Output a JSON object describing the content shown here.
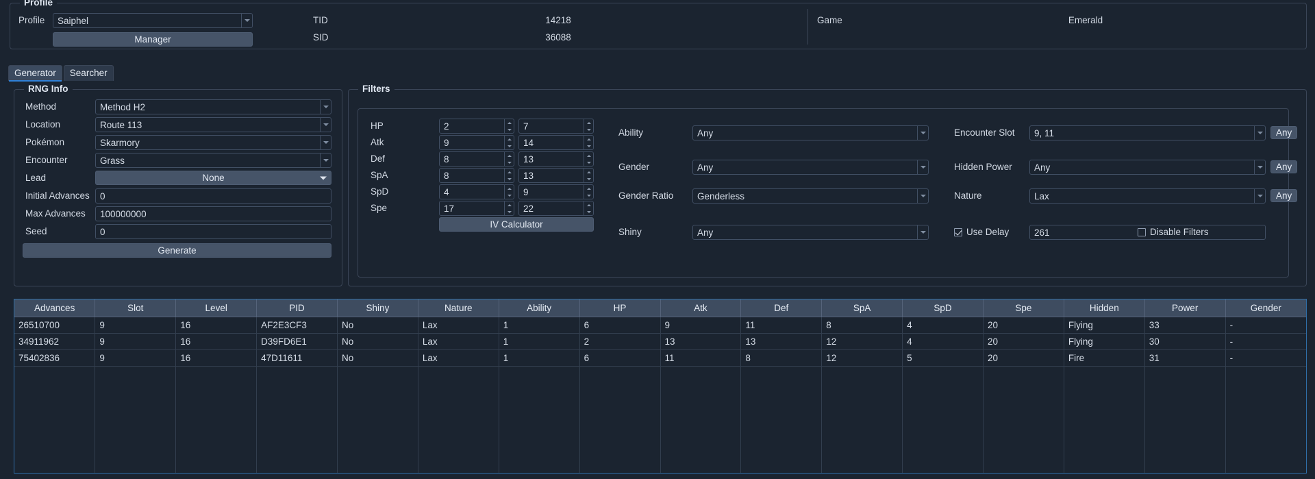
{
  "profile": {
    "group_title": "Profile",
    "profile_label": "Profile",
    "profile_value": "Saiphel",
    "manager_label": "Manager",
    "tid_label": "TID",
    "tid_value": "14218",
    "sid_label": "SID",
    "sid_value": "36088",
    "game_label": "Game",
    "game_value": "Emerald"
  },
  "tabs": [
    {
      "label": "Generator",
      "active": true
    },
    {
      "label": "Searcher",
      "active": false
    }
  ],
  "rng_info": {
    "group_title": "RNG Info",
    "rows": [
      {
        "label": "Method",
        "value": "Method H2",
        "type": "combo"
      },
      {
        "label": "Location",
        "value": "Route 113",
        "type": "combo"
      },
      {
        "label": "Pokémon",
        "value": "Skarmory",
        "type": "combo"
      },
      {
        "label": "Encounter",
        "value": "Grass",
        "type": "combo"
      },
      {
        "label": "Lead",
        "value": "None",
        "type": "button-combo"
      },
      {
        "label": "Initial Advances",
        "value": "0",
        "type": "text"
      },
      {
        "label": "Max Advances",
        "value": "100000000",
        "type": "text"
      },
      {
        "label": "Seed",
        "value": "0",
        "type": "text"
      }
    ],
    "generate_label": "Generate"
  },
  "filters": {
    "group_title": "Filters",
    "iv_rows": [
      {
        "label": "HP",
        "min": "2",
        "max": "7"
      },
      {
        "label": "Atk",
        "min": "9",
        "max": "14"
      },
      {
        "label": "Def",
        "min": "8",
        "max": "13"
      },
      {
        "label": "SpA",
        "min": "8",
        "max": "13"
      },
      {
        "label": "SpD",
        "min": "4",
        "max": "9"
      },
      {
        "label": "Spe",
        "min": "17",
        "max": "22"
      }
    ],
    "iv_calculator_label": "IV Calculator",
    "mid_rows": [
      {
        "label": "Ability",
        "value": "Any"
      },
      {
        "label": "Gender",
        "value": "Any"
      },
      {
        "label": "Gender Ratio",
        "value": "Genderless"
      },
      {
        "label": "Shiny",
        "value": "Any"
      }
    ],
    "right_rows": [
      {
        "label": "Encounter Slot",
        "value": "9, 11",
        "any_label": "Any"
      },
      {
        "label": "Hidden Power",
        "value": "Any",
        "any_label": "Any"
      },
      {
        "label": "Nature",
        "value": "Lax",
        "any_label": "Any"
      }
    ],
    "use_delay_label": "Use Delay",
    "use_delay_checked": true,
    "delay_value": "261",
    "disable_filters_label": "Disable Filters",
    "disable_filters_checked": false
  },
  "results": {
    "columns": [
      "Advances",
      "Slot",
      "Level",
      "PID",
      "Shiny",
      "Nature",
      "Ability",
      "HP",
      "Atk",
      "Def",
      "SpA",
      "SpD",
      "Spe",
      "Hidden",
      "Power",
      "Gender"
    ],
    "rows": [
      [
        "26510700",
        "9",
        "16",
        "AF2E3CF3",
        "No",
        "Lax",
        "1",
        "6",
        "9",
        "11",
        "8",
        "4",
        "20",
        "Flying",
        "33",
        "-"
      ],
      [
        "34911962",
        "9",
        "16",
        "D39FD6E1",
        "No",
        "Lax",
        "1",
        "2",
        "13",
        "13",
        "12",
        "4",
        "20",
        "Flying",
        "30",
        "-"
      ],
      [
        "75402836",
        "9",
        "16",
        "47D11611",
        "No",
        "Lax",
        "1",
        "6",
        "11",
        "8",
        "12",
        "5",
        "20",
        "Fire",
        "31",
        "-"
      ]
    ]
  },
  "colors": {
    "background": "#1b2430",
    "accent": "#2f81d8",
    "button": "#465468",
    "table_header": "#3e4c60",
    "border": "#3b4658"
  }
}
